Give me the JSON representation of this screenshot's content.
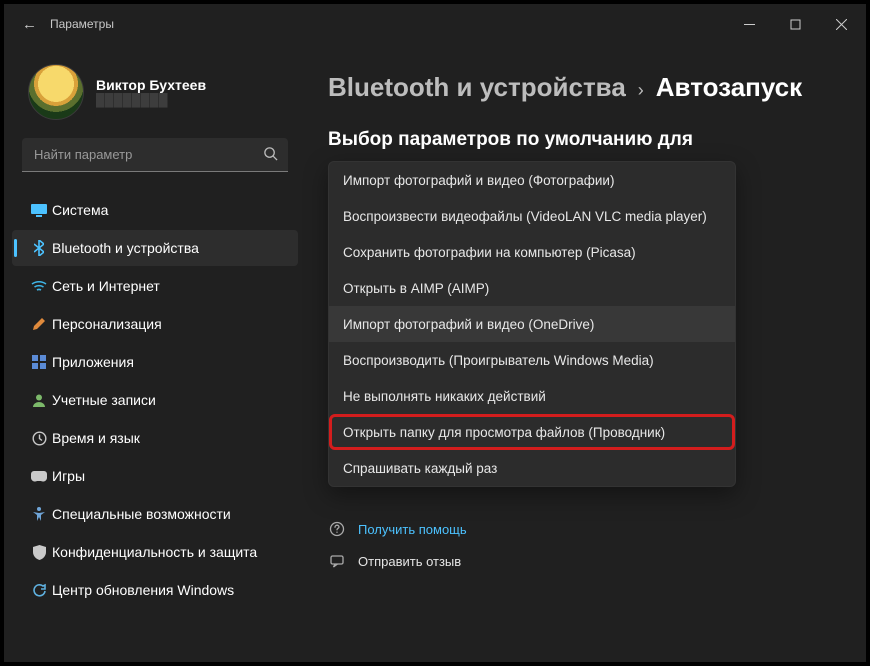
{
  "window": {
    "back_glyph": "←",
    "title": "Параметры"
  },
  "profile": {
    "name": "Виктор Бухтеев"
  },
  "search": {
    "placeholder": "Найти параметр"
  },
  "sidebar": {
    "items": [
      {
        "icon_name": "system-icon",
        "icon_color": "#4cc2ff",
        "label": "Система"
      },
      {
        "icon_name": "bluetooth-icon",
        "icon_color": "#4cc2ff",
        "label": "Bluetooth и устройства"
      },
      {
        "icon_name": "network-icon",
        "icon_color": "#3fb6e8",
        "label": "Сеть и Интернет"
      },
      {
        "icon_name": "personalize-icon",
        "icon_color": "#e08a3c",
        "label": "Персонализация"
      },
      {
        "icon_name": "apps-icon",
        "icon_color": "#5b8bd6",
        "label": "Приложения"
      },
      {
        "icon_name": "accounts-icon",
        "icon_color": "#7cb96a",
        "label": "Учетные записи"
      },
      {
        "icon_name": "time-lang-icon",
        "icon_color": "#c9c9c9",
        "label": "Время и язык"
      },
      {
        "icon_name": "gaming-icon",
        "icon_color": "#c9c9c9",
        "label": "Игры"
      },
      {
        "icon_name": "accessibility-icon",
        "icon_color": "#6fa5d8",
        "label": "Специальные возможности"
      },
      {
        "icon_name": "privacy-icon",
        "icon_color": "#c9c9c9",
        "label": "Конфиденциальность и защита"
      },
      {
        "icon_name": "update-icon",
        "icon_color": "#5fb1e0",
        "label": "Центр обновления Windows"
      }
    ],
    "active_index": 1
  },
  "breadcrumb": {
    "parent": "Bluetooth и устройства",
    "separator": "›",
    "current": "Автозапуск"
  },
  "section": {
    "title": "Выбор параметров по умолчанию для"
  },
  "dropdown": {
    "options": [
      "Импорт фотографий и видео (Фотографии)",
      "Воспроизвести видеофайлы (VideoLAN VLC media player)",
      "Сохранить фотографии на компьютер (Picasa)",
      "Открыть в AIMP (AIMP)",
      "Импорт фотографий и видео (OneDrive)",
      "Воспроизводить (Проигрыватель Windows Media)",
      "Не выполнять никаких действий",
      "Открыть папку для просмотра файлов (Проводник)",
      "Спрашивать каждый раз"
    ],
    "hover_index": 4,
    "highlight_index": 7
  },
  "footer": {
    "help": "Получить помощь",
    "feedback": "Отправить отзыв"
  }
}
